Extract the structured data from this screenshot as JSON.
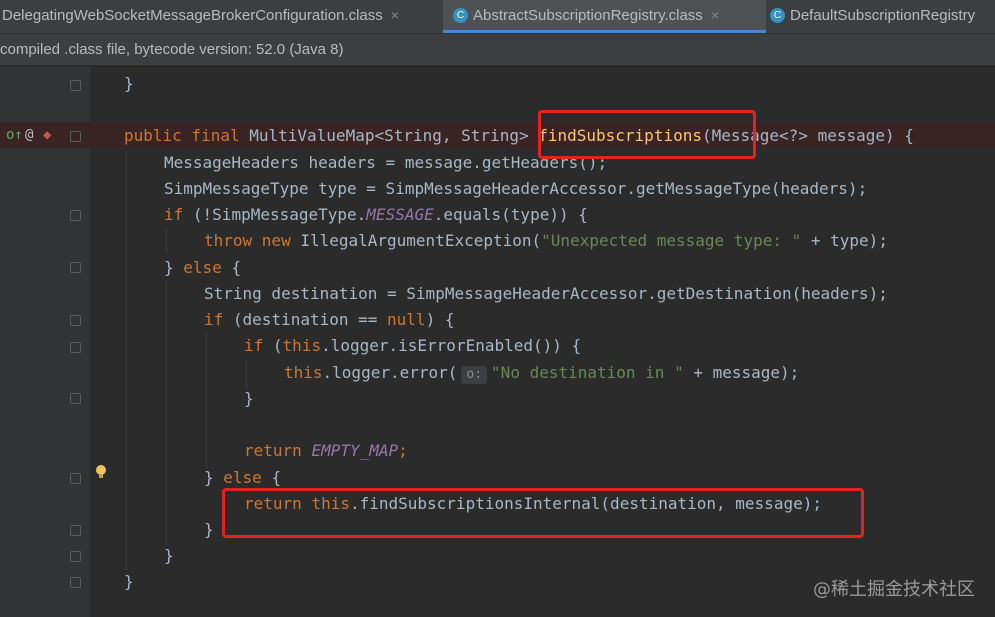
{
  "tabs": [
    {
      "label": "DelegatingWebSocketMessageBrokerConfiguration.class",
      "close": "×"
    },
    {
      "label": "AbstractSubscriptionRegistry.class",
      "close": "×",
      "icon": "C"
    },
    {
      "label": "DefaultSubscriptionRegistry",
      "icon": "C"
    }
  ],
  "info_bar": "compiled .class file, bytecode version: 52.0 (Java 8)",
  "code": {
    "l0": "}",
    "l2": {
      "a": "public final ",
      "b": "MultiValueMap<String, String> ",
      "c": "findSubscriptions",
      "d": "(Message<?> message) {"
    },
    "l3": "MessageHeaders headers = message.getHeaders();",
    "l4": "SimpMessageType type = SimpMessageHeaderAccessor.getMessageType(headers);",
    "l5": {
      "a": "if ",
      "b": "(!SimpMessageType.",
      "c": "MESSAGE",
      "d": ".equals(type)) {"
    },
    "l6": {
      "a": "throw new ",
      "b": "IllegalArgumentException(",
      "c": "\"Unexpected message type: \"",
      "d": " + type);"
    },
    "l7": {
      "a": "} ",
      "b": "else ",
      "c": "{"
    },
    "l8": "String destination = SimpMessageHeaderAccessor.getDestination(headers);",
    "l9": {
      "a": "if ",
      "b": "(destination == ",
      "c": "null",
      "d": ") {"
    },
    "l10": {
      "a": "if ",
      "b": "(",
      "c": "this",
      "d": ".logger.isErrorEnabled()) {"
    },
    "l11": {
      "a": "this",
      "b": ".logger.error(",
      "hint": "o:",
      "c": "\"No destination in \"",
      "d": " + message);"
    },
    "l12": "}",
    "l14": {
      "a": "return ",
      "b": "EMPTY_MAP",
      "c": ";"
    },
    "l15": {
      "a": "} ",
      "b": "else ",
      "c": "{"
    },
    "l16": {
      "a": "return ",
      "b": "this",
      "c": ".findSubscriptionsInternal(destination, message);"
    },
    "l17": "}",
    "l18": "}",
    "l19": "}"
  },
  "gutter_icons": {
    "override": "o↑",
    "annotation": "@",
    "breakpoint": "◆"
  },
  "watermark": "@稀土掘金技术社区",
  "colors": {
    "keyword": "#cc7832",
    "string": "#6a8759",
    "constant": "#9876aa",
    "text": "#a9b7c6",
    "highlight_box": "#e4231f"
  }
}
